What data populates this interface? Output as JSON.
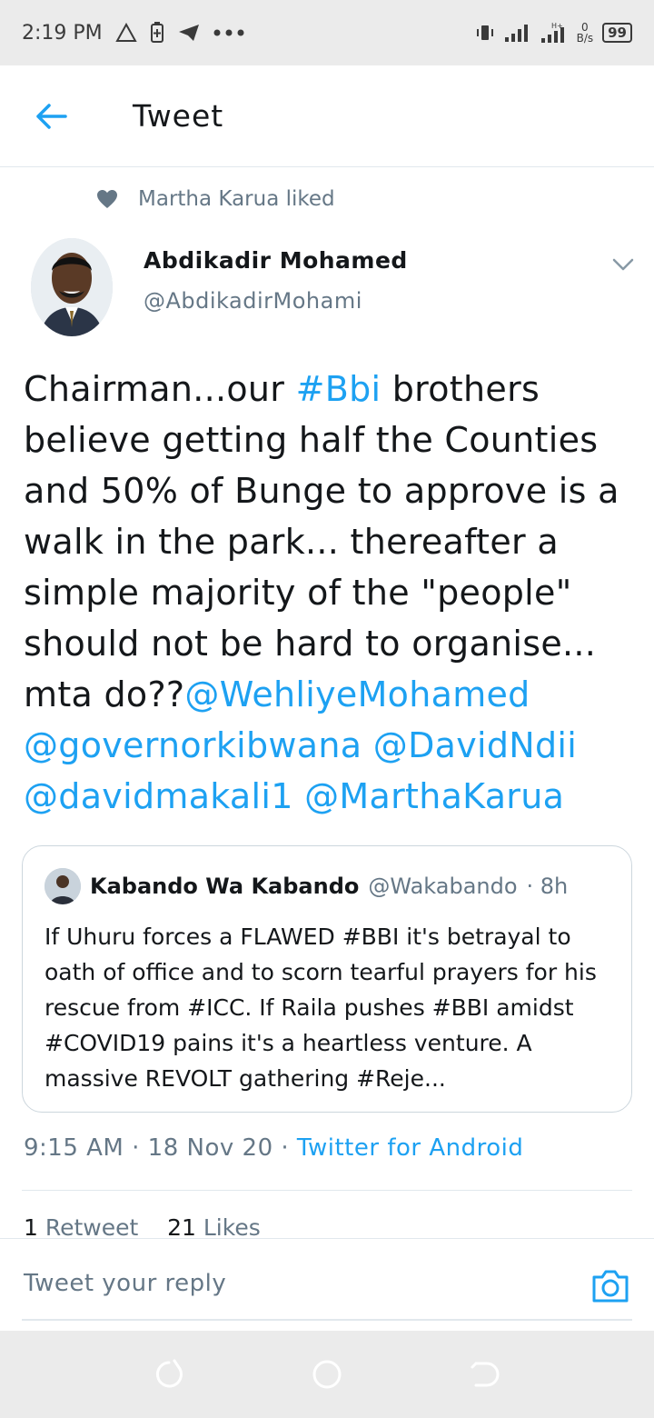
{
  "status_bar": {
    "time": "2:19 PM",
    "net_speed_value": "0",
    "net_speed_unit": "B/s",
    "battery": "99"
  },
  "header": {
    "title": "Tweet"
  },
  "social_context": {
    "text": "Martha Karua liked"
  },
  "author": {
    "name": "Abdikadir Mohamed",
    "handle": "@AbdikadirMohami"
  },
  "tweet": {
    "text_1": "Chairman...our ",
    "hashtag_1": "#Bbi",
    "text_2": " brothers believe getting half the Counties and 50% of Bunge to approve is a walk in the park... thereafter a simple majority of the \"people\" should not be hard to organise... mta do??",
    "mention_1": "@WehliyeMohamed",
    "mention_2": "@governorkibwana",
    "mention_3": "@DavidNdii",
    "mention_4": "@davidmakali1",
    "mention_5": "@MarthaKarua"
  },
  "quoted_tweet": {
    "name": "Kabando Wa Kabando",
    "handle": "@Wakabando",
    "age": "· 8h",
    "text": "If Uhuru forces a FLAWED #BBI it's betrayal to oath of office and to scorn tearful prayers for his rescue from #ICC. If Raila pushes #BBI amidst #COVID19 pains it's a heartless venture. A massive REVOLT gathering #Reje..."
  },
  "meta": {
    "time": "9:15 AM",
    "date": "18 Nov 20",
    "source": "Twitter for Android"
  },
  "stats": {
    "retweets_count": "1",
    "retweets_label": "Retweet",
    "likes_count": "21",
    "likes_label": "Likes"
  },
  "reply": {
    "placeholder": "Tweet your reply"
  },
  "colors": {
    "accent": "#1da1f2",
    "text": "#14171a",
    "muted": "#657786",
    "border": "#e1e8ed",
    "system_bar": "#ebebeb"
  },
  "icons": {
    "back": "arrow-left-icon",
    "liked": "heart-icon",
    "more": "chevron-down-icon",
    "camera": "camera-icon"
  }
}
